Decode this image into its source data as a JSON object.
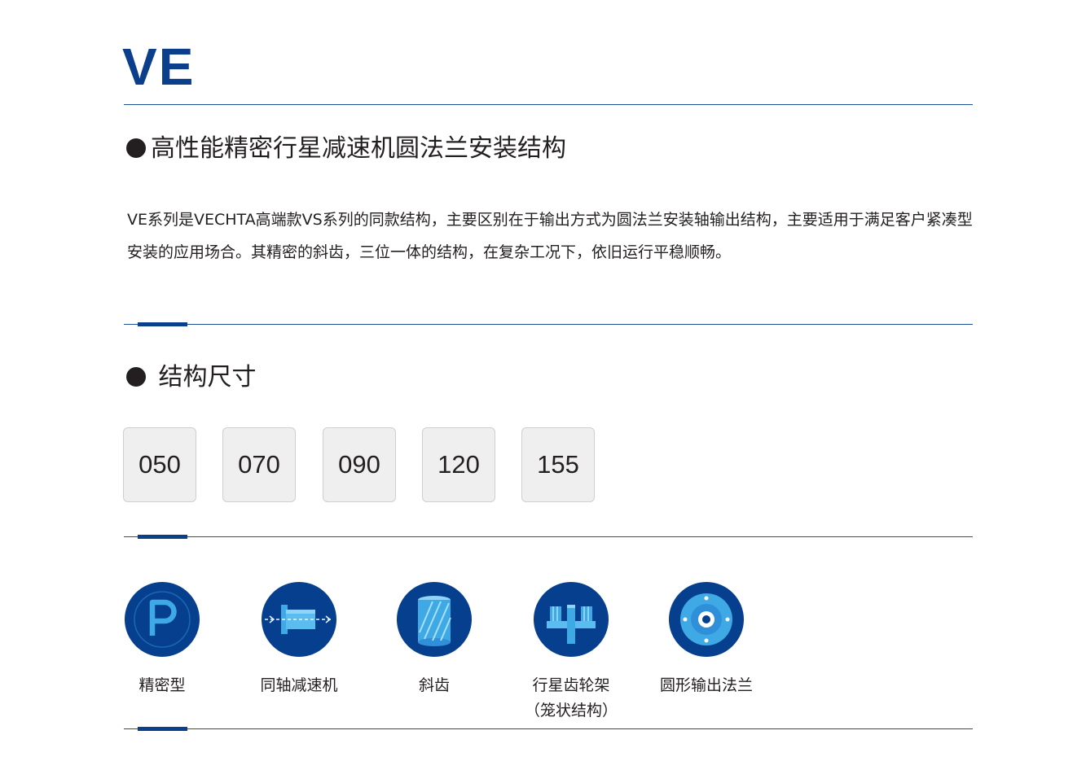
{
  "header": {
    "logo_text": "VE"
  },
  "section1": {
    "title": "高性能精密行星减速机圆法兰安装结构",
    "description": "VE系列是VECHTA高端款VS系列的同款结构，主要区别在于输出方式为圆法兰安装轴输出结构，主要适用于满足客户紧凑型安装的应用场合。其精密的斜齿，三位一体的结构，在复杂工况下，依旧运行平稳顺畅。"
  },
  "section2": {
    "title": "结构尺寸",
    "sizes": [
      "050",
      "070",
      "090",
      "120",
      "155"
    ]
  },
  "features": [
    {
      "label": "精密型",
      "icon": "precision-p-icon"
    },
    {
      "label": "同轴减速机",
      "icon": "coaxial-shaft-icon"
    },
    {
      "label": "斜齿",
      "icon": "helical-gear-icon"
    },
    {
      "label": "行星齿轮架",
      "label2": "（笼状结构）",
      "icon": "planet-carrier-icon"
    },
    {
      "label": "圆形输出法兰",
      "icon": "round-flange-icon"
    }
  ],
  "colors": {
    "brand": "#0b3f8c",
    "icon_bg": "#063f8d",
    "icon_light": "#3fa9e6",
    "button_bg": "#efefef"
  }
}
